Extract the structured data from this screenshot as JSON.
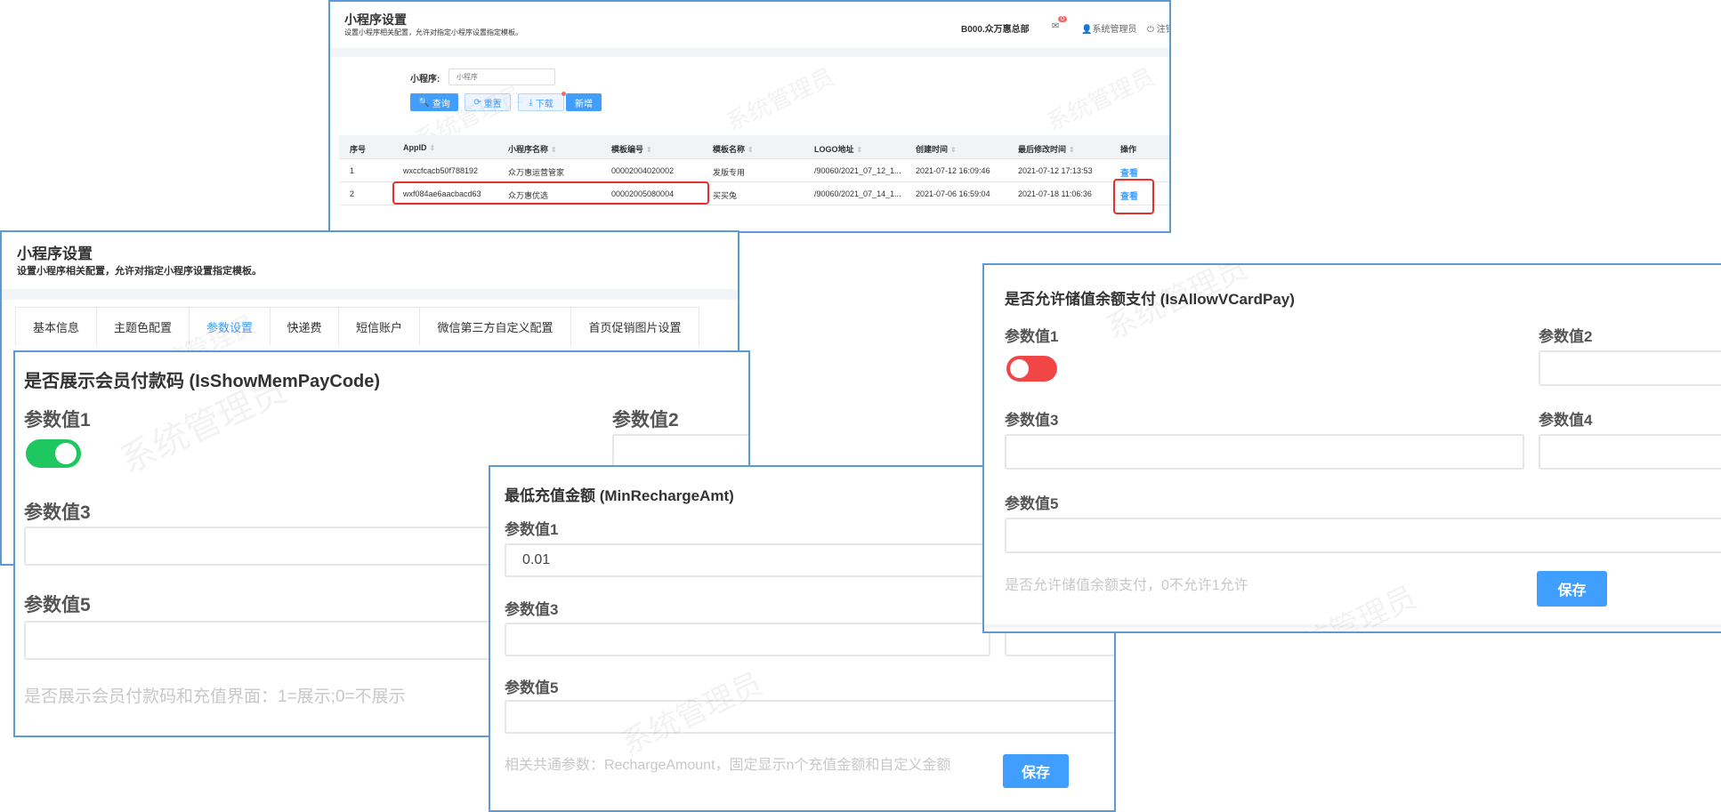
{
  "watermark": "系统管理员",
  "list_page": {
    "title": "小程序设置",
    "subtitle": "设置小程序相关配置，允许对指定小程序设置指定模板。",
    "org": "B000.众万惠总部",
    "mail_badge": "0",
    "user": "系统管理员",
    "logout": "注销",
    "filter_label": "小程序:",
    "filter_placeholder": "小程序",
    "buttons": {
      "search": "查询",
      "reset": "重置",
      "download": "下载",
      "add": "新增"
    },
    "columns": [
      "序号",
      "AppID",
      "小程序名称",
      "模板编号",
      "模板名称",
      "LOGO地址",
      "创建时间",
      "最后修改时间",
      "操作"
    ],
    "rows": [
      [
        "1",
        "wxccfcacb50f788192",
        "众万惠运营管家",
        "00002004020002",
        "发版专用",
        "/90060/2021_07_12_1...",
        "2021-07-12 16:09:46",
        "2021-07-12 17:13:53",
        "查看"
      ],
      [
        "2",
        "wxf084ae6aacbacd63",
        "众万惠优选",
        "00002005080004",
        "买买兔",
        "/90060/2021_07_14_1...",
        "2021-07-06 16:59:04",
        "2021-07-18 11:06:36",
        "查看"
      ]
    ]
  },
  "detail_page": {
    "title": "小程序设置",
    "subtitle": "设置小程序相关配置，允许对指定小程序设置指定模板。",
    "tabs": [
      "基本信息",
      "主题色配置",
      "参数设置",
      "快递费",
      "短信账户",
      "微信第三方自定义配置",
      "首页促销图片设置"
    ],
    "active_tab": "参数设置"
  },
  "params": {
    "show_pay_code": {
      "title": "是否展示会员付款码 (IsShowMemPayCode)",
      "labels": [
        "参数值1",
        "参数值2",
        "参数值3",
        "参数值5"
      ],
      "value1_on": true,
      "help": "是否展示会员付款码和充值界面：1=展示;0=不展示"
    },
    "min_recharge": {
      "title": "最低充值金额 (MinRechargeAmt)",
      "labels": [
        "参数值1",
        "参数值3",
        "参数值5"
      ],
      "value1": "0.01",
      "help": "相关共通参数：RechargeAmount，固定显示n个充值金额和自定义金额",
      "save": "保存"
    },
    "allow_vcard": {
      "title": "是否允许储值余额支付 (IsAllowVCardPay)",
      "labels": [
        "参数值1",
        "参数值2",
        "参数值3",
        "参数值4",
        "参数值5"
      ],
      "value1_on": false,
      "help": "是否允许储值余额支付，0不允许1允许",
      "save": "保存"
    }
  },
  "colors": {
    "accent": "#409eff",
    "toggle_on": "#1ec760",
    "toggle_off": "#f24646",
    "highlight": "#e53030"
  }
}
